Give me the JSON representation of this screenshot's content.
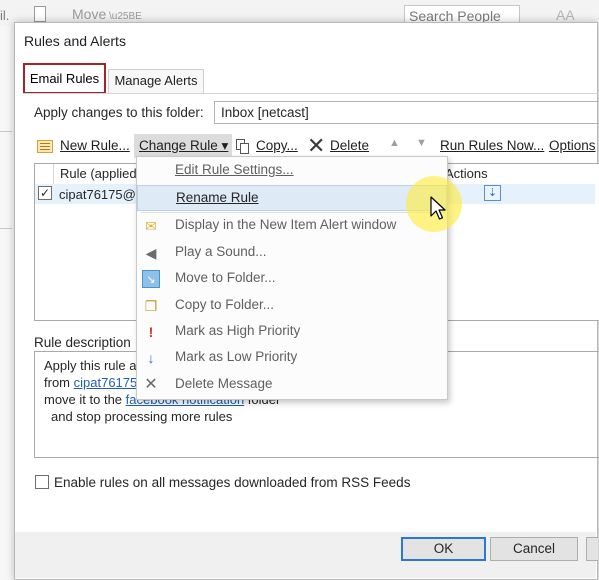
{
  "background": {
    "left_fragment": "il.",
    "move_label": "Move",
    "search_placeholder": "Search People",
    "right_text": "AΑ"
  },
  "dialog": {
    "title": "Rules and Alerts",
    "tabs": [
      {
        "label": "Email Rules",
        "selected": true
      },
      {
        "label": "Manage Alerts",
        "selected": false
      }
    ],
    "apply_label": "Apply changes to this folder:",
    "folder_value": "Inbox [netcast]"
  },
  "toolbar": {
    "new_rule": "New Rule...",
    "change_rule": "Change Rule ▾",
    "copy": "Copy...",
    "delete": "Delete",
    "run_rules_now": "Run Rules Now...",
    "options": "Options"
  },
  "rules_list": {
    "col_rule": "Rule (applied",
    "col_actions": "Actions",
    "rows": [
      {
        "name": "cipat76175@",
        "checked": true
      }
    ]
  },
  "description": {
    "label": "Rule description",
    "line1": "Apply this rule a",
    "line2_prefix": "from ",
    "line2_link": "cipat76175",
    "line3_prefix": "move it to the ",
    "line3_link": "facebook notification",
    "line3_suffix": " folder",
    "line4": "and stop processing more rules"
  },
  "rss_option": {
    "label": "Enable rules on all messages downloaded from RSS Feeds",
    "checked": false
  },
  "buttons": {
    "ok": "OK",
    "cancel": "Cancel"
  },
  "change_rule_menu": {
    "items": [
      {
        "label": "Edit Rule Settings...",
        "icon": "none",
        "highlighted": false
      },
      {
        "label": "Rename Rule",
        "icon": "none",
        "highlighted": true
      },
      {
        "label": "Display in the New Item Alert window",
        "icon": "alert-envelope-icon",
        "highlighted": false
      },
      {
        "label": "Play a Sound...",
        "icon": "speaker-icon",
        "highlighted": false
      },
      {
        "label": "Move to Folder...",
        "icon": "move-folder-icon",
        "highlighted": false
      },
      {
        "label": "Copy to Folder...",
        "icon": "copy-folder-icon",
        "highlighted": false
      },
      {
        "label": "Mark as High Priority",
        "icon": "high-priority-icon",
        "highlighted": false
      },
      {
        "label": "Mark as Low Priority",
        "icon": "low-priority-icon",
        "highlighted": false
      },
      {
        "label": "Delete Message",
        "icon": "delete-x-icon",
        "highlighted": false
      }
    ]
  },
  "colors": {
    "tab_highlight_border": "#a3232b",
    "link": "#1f5fb4",
    "menu_highlight": "#dfeaf7",
    "ok_border": "#2a78d4",
    "cursor_halo": "#ffec3c"
  }
}
